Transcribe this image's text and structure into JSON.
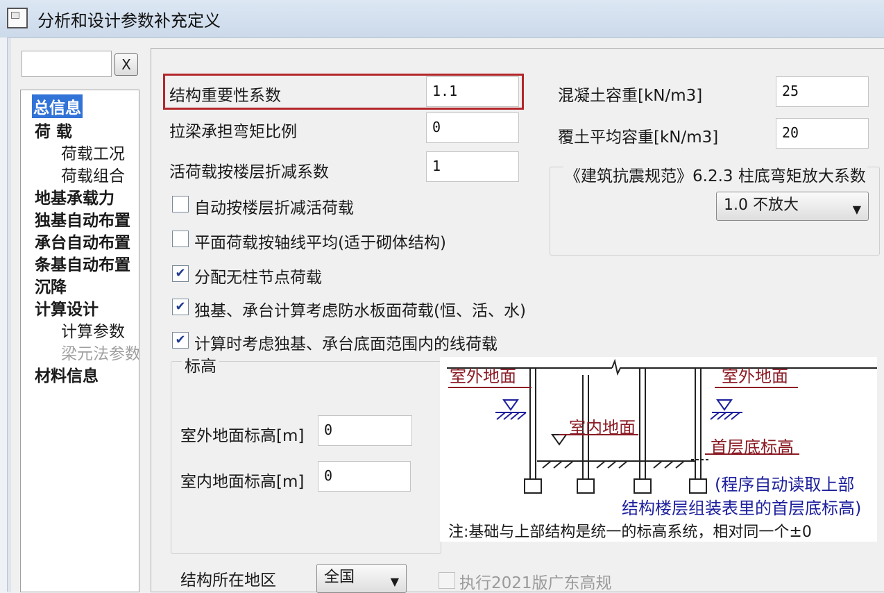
{
  "window": {
    "title": "分析和设计参数补充定义"
  },
  "sidebar": {
    "search_value": "",
    "clear_label": "X",
    "tree": [
      {
        "label": "总信息",
        "selected": true
      },
      {
        "label": "荷  载"
      },
      {
        "label": "荷载工况"
      },
      {
        "label": "荷载组合"
      },
      {
        "label": "地基承载力"
      },
      {
        "label": "独基自动布置"
      },
      {
        "label": "承台自动布置"
      },
      {
        "label": "条基自动布置"
      },
      {
        "label": "沉降"
      },
      {
        "label": "计算设计"
      },
      {
        "label": "计算参数"
      },
      {
        "label": "梁元法参数",
        "disabled": true
      },
      {
        "label": "材料信息"
      }
    ]
  },
  "form": {
    "importance": {
      "label": "结构重要性系数",
      "value": "1.1"
    },
    "tie_beam": {
      "label": "拉梁承担弯矩比例",
      "value": "0"
    },
    "live_reduction": {
      "label": "活荷载按楼层折减系数",
      "value": "1"
    },
    "concrete_density": {
      "label": "混凝土容重[kN/m3]",
      "value": "25"
    },
    "soil_density": {
      "label": "覆土平均容重[kN/m3]",
      "value": "20"
    },
    "seismic_factor": {
      "label": "《建筑抗震规范》6.2.3 柱底弯矩放大系数",
      "value": "1.0    不放大"
    },
    "checkboxes": [
      {
        "label": "自动按楼层折减活荷载",
        "checked": false
      },
      {
        "label": "平面荷载按轴线平均(适于砌体结构)",
        "checked": false
      },
      {
        "label": "分配无柱节点荷载",
        "checked": true
      },
      {
        "label": "独基、承台计算考虑防水板面荷载(恒、活、水)",
        "checked": true
      },
      {
        "label": "计算时考虑独基、承台底面范围内的线荷载",
        "checked": true
      }
    ],
    "elevation": {
      "group_label": "标高",
      "outdoor": {
        "label": "室外地面标高[m]",
        "value": "0"
      },
      "indoor": {
        "label": "室内地面标高[m]",
        "value": "0"
      }
    },
    "region": {
      "label": "结构所在地区",
      "value": "全国"
    },
    "guangdong": {
      "label": "执行2021版广东高规",
      "checked": false,
      "disabled": true
    }
  },
  "diagram": {
    "outdoor_left": "室外地面",
    "outdoor_right": "室外地面",
    "indoor": "室内地面",
    "first_floor": "首层底标高",
    "auto_note_1": "(程序自动读取上部",
    "auto_note_2": "结构楼层组装表里的首层底标高)",
    "note": "注:基础与上部结构是统一的标高系统，相对同一个±0",
    "colors": {
      "dark_red": "#8b1b24",
      "blue": "#1c1f9c"
    }
  },
  "colors": {
    "highlight": "#b3262a",
    "selection": "#3173d6"
  }
}
